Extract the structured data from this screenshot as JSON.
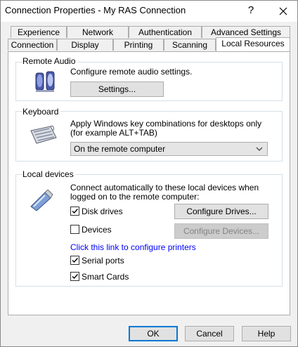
{
  "window": {
    "title": "Connection Properties - My RAS Connection",
    "help_label": "?",
    "close_label": "✕"
  },
  "tabs_row1": [
    "Experience",
    "Network",
    "Authentication",
    "Advanced Settings"
  ],
  "tabs_row2": [
    "Connection",
    "Display",
    "Printing",
    "Scanning",
    "Local Resources"
  ],
  "active_tab": "Local Resources",
  "remote_audio": {
    "title": "Remote Audio",
    "description": "Configure remote audio settings.",
    "settings_button": "Settings...",
    "icon": "speakers-icon"
  },
  "keyboard": {
    "title": "Keyboard",
    "description_line1": "Apply Windows key combinations for desktops only",
    "description_line2": "(for example ALT+TAB)",
    "selected_option": "On the remote computer",
    "icon": "keyboard-icon"
  },
  "local_devices": {
    "title": "Local devices",
    "description_line1": "Connect automatically to these local devices when",
    "description_line2": "logged on to the remote computer:",
    "icon": "usb-drive-icon",
    "disk_drives": {
      "label": "Disk drives",
      "checked": true
    },
    "configure_drives": "Configure Drives...",
    "devices": {
      "label": "Devices",
      "checked": false
    },
    "configure_devices": "Configure Devices...",
    "printers_link": "Click this link to configure printers",
    "serial_ports": {
      "label": "Serial ports",
      "checked": true
    },
    "smart_cards": {
      "label": "Smart Cards",
      "checked": true
    }
  },
  "footer": {
    "ok": "OK",
    "cancel": "Cancel",
    "help": "Help"
  }
}
